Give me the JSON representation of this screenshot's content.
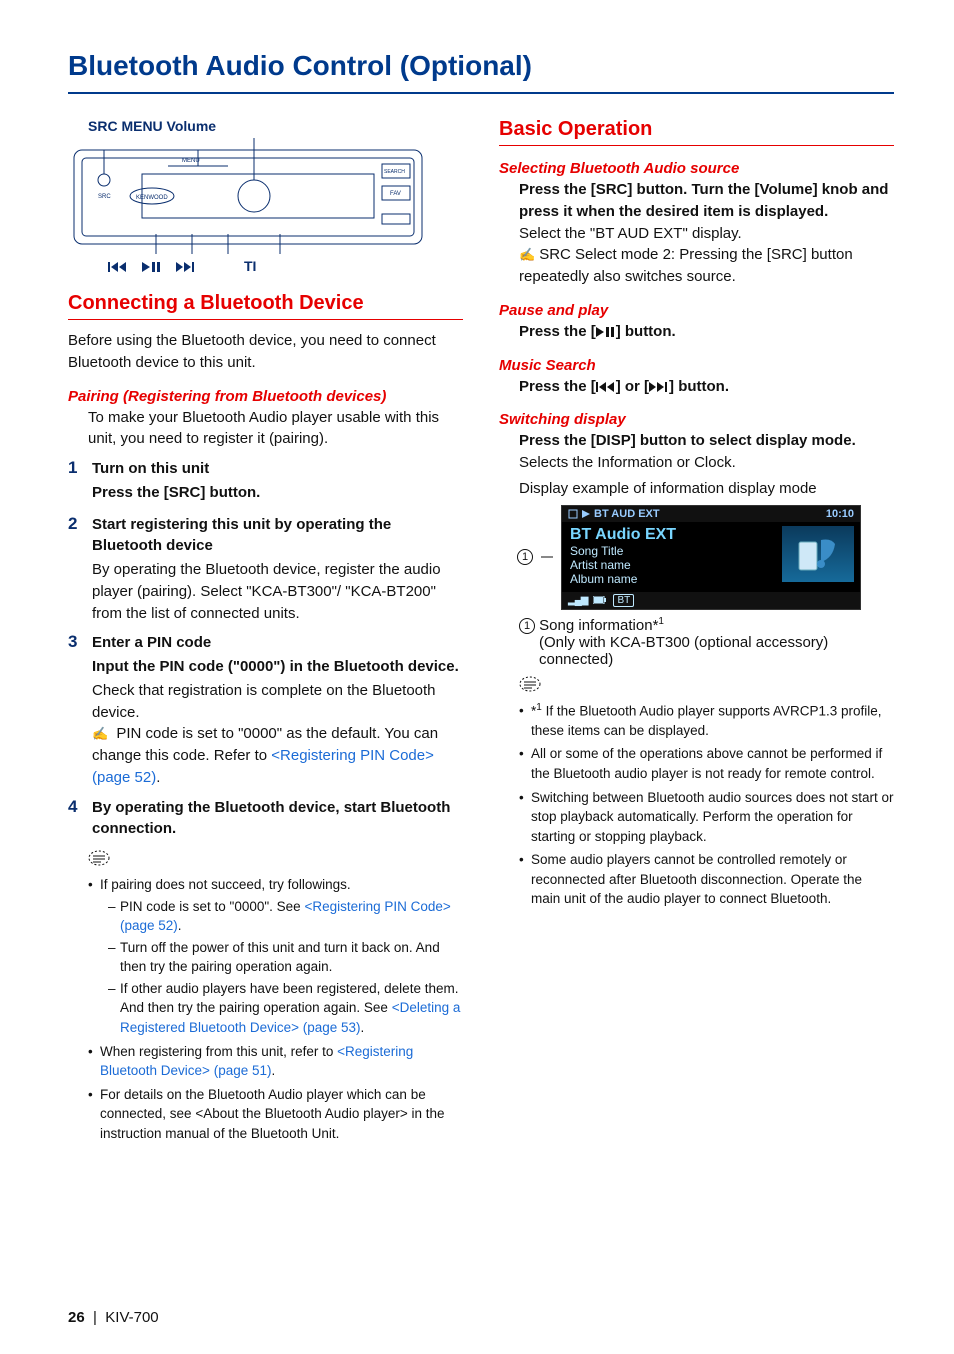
{
  "page": {
    "title": "Bluetooth Audio Control (Optional)",
    "number": "26",
    "model": "KIV-700",
    "footer_sep": "|"
  },
  "device": {
    "top_labels": "SRC   MENU   Volume",
    "bottom_ti": "TI"
  },
  "left": {
    "heading": "Connecting a Bluetooth Device",
    "intro": "Before using the Bluetooth device, you need to connect Bluetooth device to this unit.",
    "pairing_sub": "Pairing (Registering from Bluetooth devices)",
    "pairing_text": "To make your Bluetooth Audio player usable with this unit, you need to register it (pairing).",
    "step1_title": "Turn on this unit",
    "step1_body": "Press the [SRC] button.",
    "step2_title": "Start registering this unit by operating the Bluetooth device",
    "step2_body": "By operating the Bluetooth device, register the audio player (pairing). Select \"KCA-BT300\"/ \"KCA-BT200\" from the list of connected units.",
    "step3_title": "Enter a PIN code",
    "step3_sub": "Input the PIN code (\"0000\") in the Bluetooth device.",
    "step3_body": "Check that registration is complete on the Bluetooth device.",
    "step3_pen_a": "PIN code is set to \"0000\" as the default. You can change this code. Refer to ",
    "step3_pen_link": "<Registering PIN Code> (page 52)",
    "step3_pen_b": ".",
    "step4_title": "By operating the Bluetooth device, start Bluetooth connection.",
    "notes": {
      "n1": "If pairing does not succeed, try followings.",
      "n1a_a": "PIN code is set to \"0000\". See ",
      "n1a_link": "<Registering PIN Code> (page 52)",
      "n1a_b": ".",
      "n1b": "Turn off the power of this unit and turn it back on. And then try the pairing operation again.",
      "n1c_a": "If other audio players have been registered, delete them. And then try the pairing operation again. See ",
      "n1c_link": "<Deleting a Registered Bluetooth Device> (page 53)",
      "n1c_b": ".",
      "n2_a": "When registering from this unit, refer to ",
      "n2_link": "<Registering Bluetooth Device> (page 51)",
      "n2_b": ".",
      "n3": "For details on the Bluetooth Audio player which can be connected, see <About the Bluetooth Audio player> in the instruction manual of the Bluetooth Unit."
    }
  },
  "right": {
    "heading": "Basic Operation",
    "sel_sub": "Selecting Bluetooth Audio source",
    "sel_bold": "Press the [SRC] button. Turn the [Volume] knob and press it when the desired item is displayed.",
    "sel_body": "Select the \"BT AUD EXT\"  display.",
    "sel_pen": "SRC Select mode 2: Pressing the [SRC] button repeatedly also switches source.",
    "pause_sub": "Pause and play",
    "pause_body_a": "Press the [",
    "pause_body_b": "] button.",
    "music_sub": "Music Search",
    "music_a": "Press the [",
    "music_b": "] or [",
    "music_c": "] button.",
    "switch_sub": "Switching display",
    "switch_bold": "Press the [DISP] button to select display mode.",
    "switch_body": "Selects the Information or Clock.",
    "display_caption": "Display example of information display mode",
    "display": {
      "header_left": "BT AUD EXT",
      "header_right": "10:10",
      "line1": "BT Audio EXT",
      "line2": "Song Title",
      "line3": "Artist name",
      "line4": "Album name",
      "bt_badge": "BT"
    },
    "fn_label": "1",
    "fn_text_a": "Song information*",
    "fn_text_sup": "1",
    "fn_text_b": "(Only with KCA-BT300 (optional accessory) connected)",
    "notes": {
      "n1_pre": "*",
      "n1_sup": "1",
      "n1": " If the Bluetooth Audio player supports AVRCP1.3 profile, these items can be displayed.",
      "n2": "All or some of the operations above cannot be performed if the Bluetooth audio player is not ready for remote control.",
      "n3": "Switching between Bluetooth audio sources does not start or stop playback automatically. Perform the operation for starting or stopping playback.",
      "n4": "Some audio players cannot be controlled remotely or reconnected after Bluetooth disconnection. Operate the main unit of the audio player to connect Bluetooth."
    }
  }
}
